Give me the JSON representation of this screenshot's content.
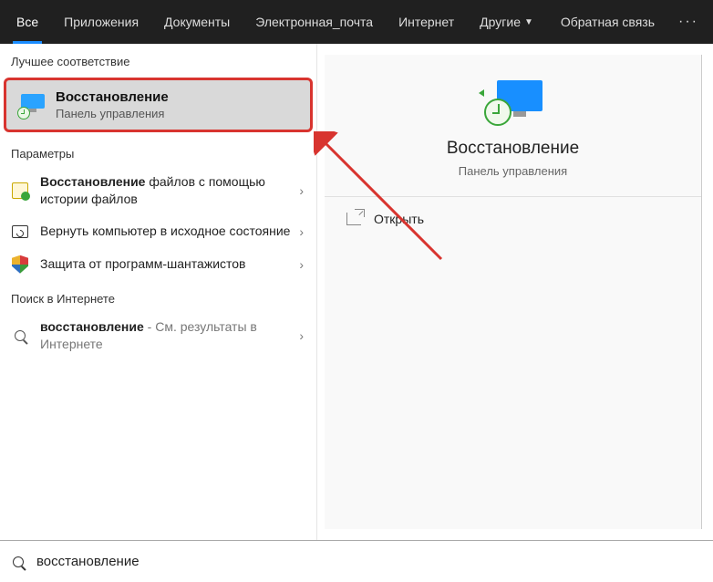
{
  "tabs": {
    "items": [
      {
        "label": "Все",
        "active": true
      },
      {
        "label": "Приложения",
        "active": false
      },
      {
        "label": "Документы",
        "active": false
      },
      {
        "label": "Электронная_почта",
        "active": false
      },
      {
        "label": "Интернет",
        "active": false
      },
      {
        "label": "Другие",
        "active": false,
        "dropdown": true
      }
    ],
    "feedback": "Обратная связь",
    "more": "···"
  },
  "sections": {
    "best_match": "Лучшее соответствие",
    "settings": "Параметры",
    "web": "Поиск в Интернете"
  },
  "best": {
    "title": "Восстановление",
    "subtitle": "Панель управления"
  },
  "settings_items": [
    {
      "bold": "Восстановление",
      "rest": " файлов с помощью истории файлов",
      "icon": "file-history"
    },
    {
      "bold": "",
      "rest": "Вернуть компьютер в исходное состояние",
      "icon": "reset"
    },
    {
      "bold": "",
      "rest": "Защита от программ-шантажистов",
      "icon": "shield"
    }
  ],
  "web_items": [
    {
      "bold": "восстановление",
      "rest": " - См. результаты в Интернете",
      "icon": "search"
    }
  ],
  "preview": {
    "title": "Восстановление",
    "subtitle": "Панель управления",
    "open": "Открыть"
  },
  "search": {
    "value": "восстановление"
  }
}
